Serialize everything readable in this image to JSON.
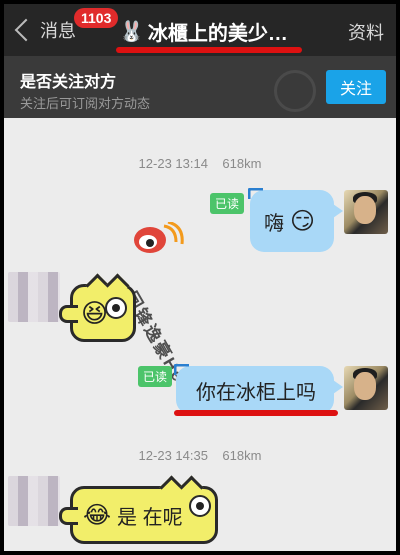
{
  "header": {
    "back_label": "消息",
    "unread_badge": "1103",
    "title_icon": "rabbit-icon",
    "title": "冰櫃上的美少…",
    "profile_label": "资料"
  },
  "follow_banner": {
    "title": "是否关注对方",
    "subtitle": "关注后可订阅对方动态",
    "button_label": "关注",
    "accent_color": "#1aa3e8"
  },
  "messages": [
    {
      "type": "timestamp",
      "time": "12-23 13:14",
      "distance": "618km"
    },
    {
      "type": "sent",
      "status": "已读",
      "text": "嗨",
      "emoji": "😏"
    },
    {
      "type": "received",
      "emoji": "😆"
    },
    {
      "type": "sent",
      "status": "已读",
      "text": "你在冰柜上吗"
    },
    {
      "type": "timestamp",
      "time": "12-23 14:35",
      "distance": "618km"
    },
    {
      "type": "received",
      "emoji": "😂",
      "text": "是 在呢"
    }
  ],
  "watermark": {
    "text": "回锋逸豪Hero"
  },
  "colors": {
    "topbar": "#262626",
    "sent_bubble": "#a9d8f7",
    "received_bubble": "#f2ee6a",
    "read_badge": "#4cc46a",
    "highlight_underline": "#dd1111"
  }
}
